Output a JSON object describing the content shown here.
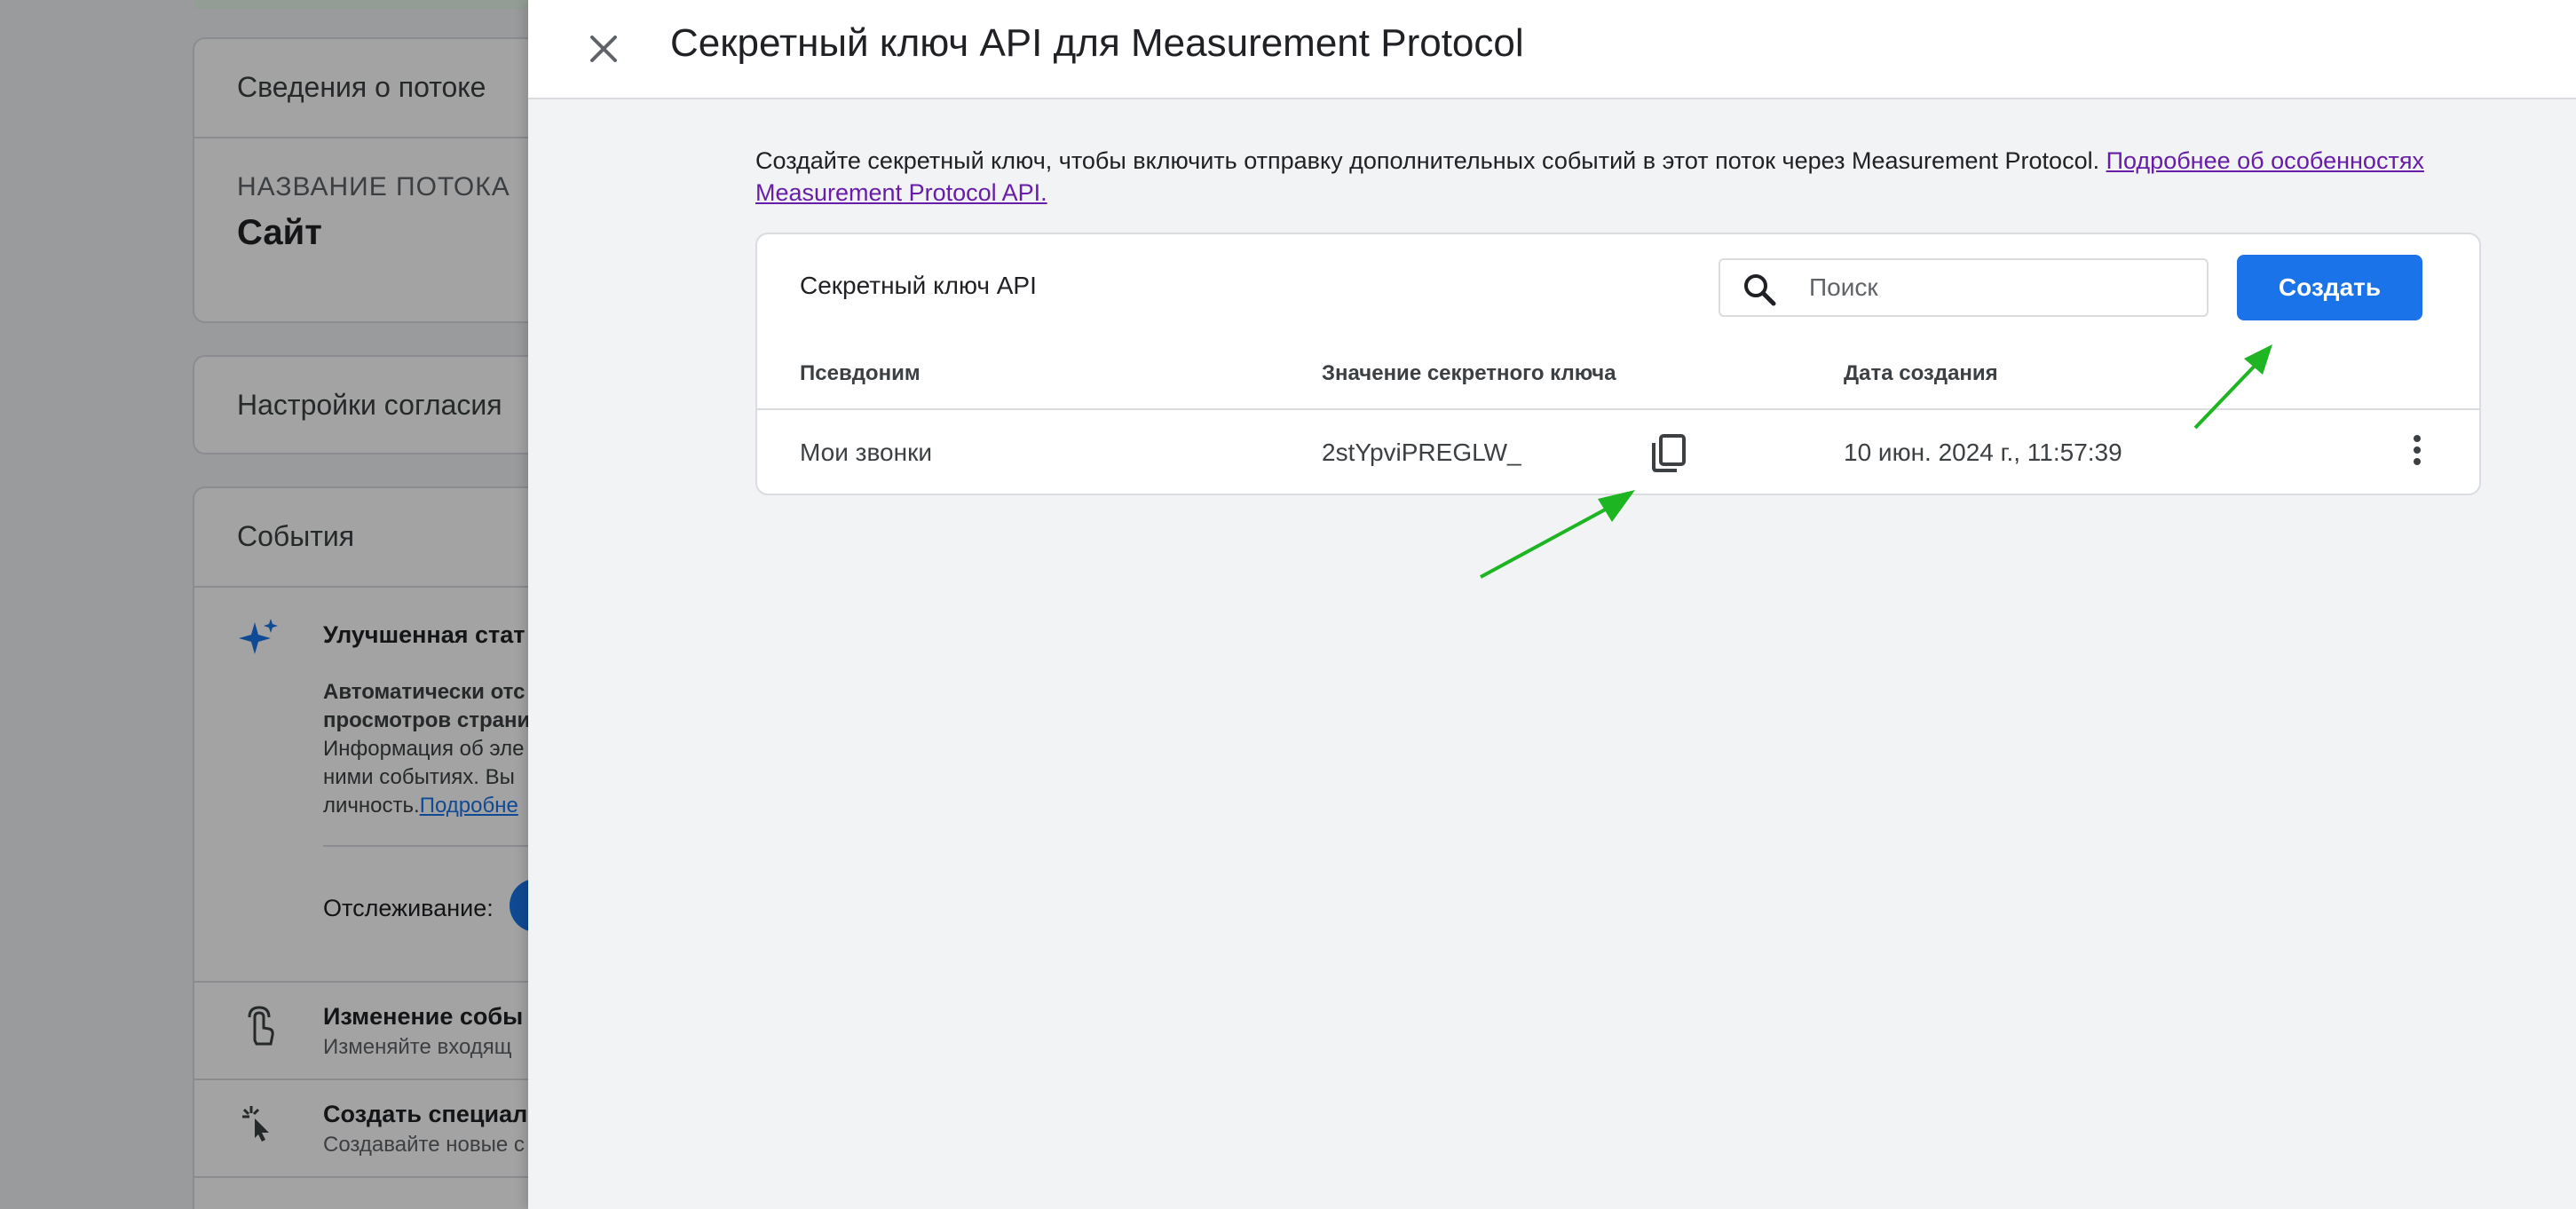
{
  "background": {
    "stream_info_title": "Сведения о потоке",
    "stream_name_label": "НАЗВАНИЕ ПОТОКА",
    "stream_name_value": "Сайт",
    "consent_title": "Настройки согласия",
    "events_title": "События",
    "enhanced_title": "Улучшенная стат",
    "enhanced_line1": "Автоматически отс",
    "enhanced_line2": "просмотров страни",
    "enhanced_line3": "Информация об эле",
    "enhanced_line4": "ними событиях. Вы",
    "enhanced_line5_text": "личность.",
    "enhanced_line5_link": "Подробне",
    "tracking_label": "Отслеживание:",
    "modify_title": "Изменение собы",
    "modify_sub": "Изменяйте входящ",
    "custom_title": "Создать специал",
    "custom_sub": "Создавайте новые с"
  },
  "panel": {
    "title": "Секретный ключ API для Measurement Protocol",
    "description": "Создайте секретный ключ, чтобы включить отправку дополнительных событий в этот поток через Measurement Protocol. ",
    "description_link_line1": "Подробнее об особенностях",
    "description_link_line2": "Measurement Protocol API."
  },
  "table": {
    "title": "Секретный ключ API",
    "search_placeholder": "Поиск",
    "create_label": "Создать",
    "columns": [
      "Псевдоним",
      "Значение секретного ключа",
      "Дата создания"
    ],
    "rows": [
      {
        "alias": "Мои звонки",
        "secret": "2stYpviPREGLW_",
        "created": "10 июн. 2024 г., 11:57:39"
      }
    ]
  },
  "icons": {
    "close": "close-icon",
    "search": "search-icon",
    "copy": "copy-icon",
    "more": "more-vert-icon",
    "sparkle": "sparkle-icon",
    "touch": "touch-icon",
    "cursor": "cursor-click-icon"
  },
  "colors": {
    "primary": "#1a73e8",
    "link_visited": "#681da8",
    "annotation_arrow": "#1db522"
  }
}
